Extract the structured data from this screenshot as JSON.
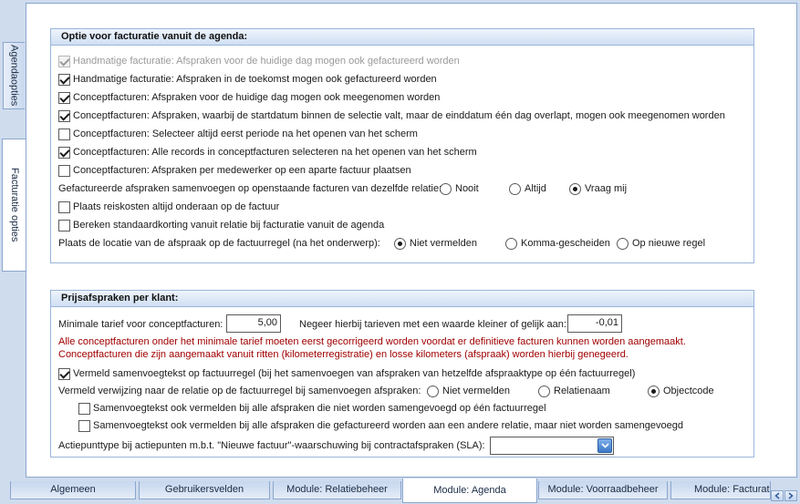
{
  "side_tabs": [
    {
      "label": "Agendaopties"
    },
    {
      "label": "Facturatie opties"
    }
  ],
  "group1": {
    "title": "Optie voor facturatie vanuit de agenda:",
    "options": [
      {
        "label": "Handmatige facturatie: Afspraken voor de huidige dag mogen ook gefactureerd worden",
        "checked": true,
        "disabled": true
      },
      {
        "label": "Handmatige facturatie: Afspraken in de toekomst mogen ook gefactureerd worden",
        "checked": true
      },
      {
        "label": "Conceptfacturen: Afspraken voor de huidige dag mogen ook meegenomen worden",
        "checked": true
      },
      {
        "label": "Conceptfacturen: Afspraken, waarbij de startdatum binnen de selectie valt, maar de einddatum één dag overlapt, mogen ook meegenomen worden",
        "checked": true
      },
      {
        "label": "Conceptfacturen: Selecteer altijd eerst periode na het openen van het scherm",
        "checked": false
      },
      {
        "label": "Conceptfacturen: Alle records in conceptfacturen selecteren na het openen van het scherm",
        "checked": true
      },
      {
        "label": "Conceptfacturen: Afspraken per medewerker op een aparte factuur plaatsen",
        "checked": false
      }
    ],
    "merge": {
      "label": "Gefactureerde afspraken samenvoegen op openstaande facturen van dezelfde relatie:",
      "options": [
        "Nooit",
        "Altijd",
        "Vraag mij"
      ],
      "selected": "Vraag mij"
    },
    "travel_costs": {
      "label": "Plaats reiskosten altijd onderaan op de factuur",
      "checked": false
    },
    "discount": {
      "label": "Bereken standaardkorting vanuit relatie bij facturatie vanuit de agenda",
      "checked": false
    },
    "location": {
      "label": "Plaats de locatie van de afspraak op de factuurregel (na het onderwerp):",
      "options": [
        "Niet vermelden",
        "Komma-gescheiden",
        "Op nieuwe regel"
      ],
      "selected": "Niet vermelden"
    }
  },
  "group2": {
    "title": "Prijsafspraken per klant:",
    "min_rate_label": "Minimale tarief voor conceptfacturen:",
    "min_rate_value": "5,00",
    "ignore_label": "Negeer hierbij tarieven met een waarde kleiner of gelijk aan:",
    "ignore_value": "-0,01",
    "warning_lines": [
      "Alle conceptfacturen onder het minimale tarief moeten eerst gecorrigeerd worden voordat er definitieve facturen kunnen worden aangemaakt.",
      "Conceptfacturen die zijn aangemaakt vanuit ritten (kilometerregistratie) en losse kilometers (afspraak) worden hierbij genegeerd."
    ],
    "merge_text": {
      "label": "Vermeld samenvoegtekst op factuurregel (bij het samenvoegen van afspraken van hetzelfde afspraaktype op één factuurregel)",
      "checked": true
    },
    "reference": {
      "label": "Vermeld verwijzing naar de relatie op de factuurregel bij samenvoegen afspraken:",
      "options": [
        "Niet vermelden",
        "Relatienaam",
        "Objectcode"
      ],
      "selected": "Objectcode"
    },
    "sub_options": [
      {
        "label": "Samenvoegtekst ook vermelden bij alle afspraken die niet worden samengevoegd op één factuurregel",
        "checked": false
      },
      {
        "label": "Samenvoegtekst ook vermelden bij alle afspraken die gefactureerd worden aan een andere relatie, maar niet worden samengevoegd",
        "checked": false
      }
    ],
    "action_label": "Actiepunttype bij actiepunten m.b.t. \"Nieuwe factuur\"-waarschuwing bij contractafspraken (SLA):",
    "action_value": ""
  },
  "bottom_tabs": [
    {
      "label": "Algemeen"
    },
    {
      "label": "Gebruikersvelden"
    },
    {
      "label": "Module: Relatiebeheer"
    },
    {
      "label": "Module: Agenda"
    },
    {
      "label": "Module: Voorraadbeheer"
    },
    {
      "label": "Module: Facturatie"
    }
  ],
  "active_bottom_tab": "Module: Agenda",
  "active_side_tab": "Facturatie opties"
}
